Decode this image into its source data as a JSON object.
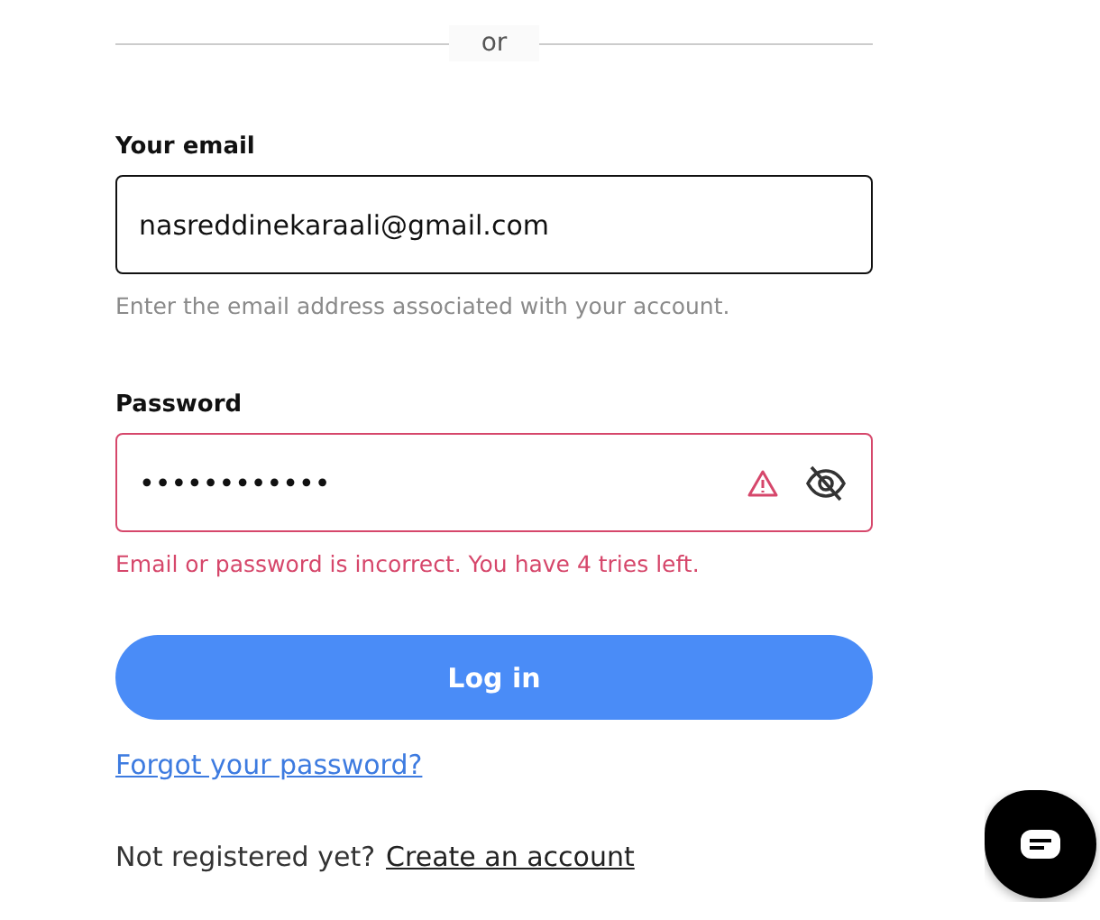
{
  "divider": {
    "label": "or"
  },
  "email": {
    "label": "Your email",
    "value": "nasreddinekaraali@gmail.com",
    "hint": "Enter the email address associated with your account.",
    "error": false
  },
  "password": {
    "label": "Password",
    "value": "••••••••••••",
    "error": true,
    "message": "Email or password is incorrect. You have 4 tries left."
  },
  "login_button": "Log in",
  "forgot_link": "Forgot your password?",
  "register": {
    "prompt": "Not registered yet?",
    "link": "Create an account"
  }
}
